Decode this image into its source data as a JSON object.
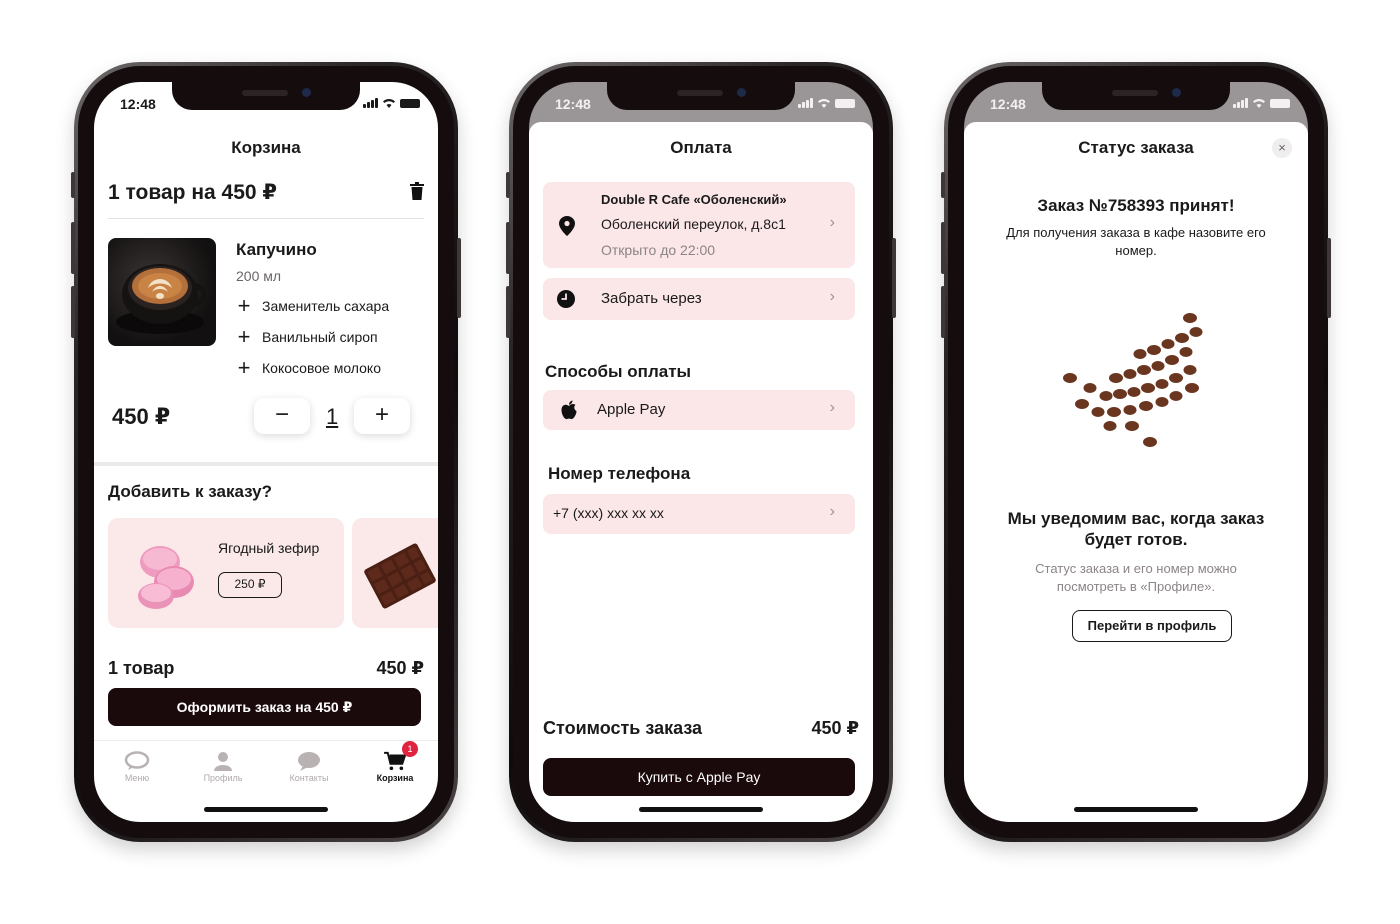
{
  "status_bar": {
    "time": "12:48"
  },
  "cart": {
    "title": "Корзина",
    "summary": "1 товар на 450 ₽",
    "item": {
      "name": "Капучино",
      "volume": "200 мл",
      "addons": [
        "Заменитель сахара",
        "Ванильный сироп",
        "Кокосовое молоко"
      ],
      "price": "450 ₽",
      "quantity": "1",
      "minus": "−",
      "plus": "+"
    },
    "upsell_title": "Добавить к заказу?",
    "upsell_items": [
      {
        "name": "Ягодный зефир",
        "price": "250 ₽"
      }
    ],
    "total_count": "1 товар",
    "total_price": "450 ₽",
    "checkout_button": "Оформить заказ на 450 ₽",
    "tabs": [
      {
        "label": "Меню",
        "icon": "chat-bubble-icon"
      },
      {
        "label": "Профиль",
        "icon": "user-icon"
      },
      {
        "label": "Контакты",
        "icon": "speech-icon"
      },
      {
        "label": "Корзина",
        "icon": "cart-icon",
        "badge": "1",
        "active": true
      }
    ]
  },
  "payment": {
    "title": "Оплата",
    "cafe_name": "Double R Cafe «Оболенский»",
    "cafe_address": "Оболенский переулок, д.8с1",
    "cafe_hours": "Открыто до 22:00",
    "pickup_label": "Забрать через",
    "methods_title": "Способы оплаты",
    "method": "Apple Pay",
    "phone_title": "Номер телефона",
    "phone_placeholder": "+7 (xxx) xxx xx xx",
    "cost_label": "Стоимость заказа",
    "cost_value": "450 ₽",
    "buy_button": "Купить с Apple Pay"
  },
  "order_status": {
    "title": "Статус заказа",
    "close": "×",
    "order_number": "Заказ №758393 принят!",
    "hint": "Для получения заказа в кафе назовите его номер.",
    "notify": "Мы уведомим вас, когда заказ будет готов.",
    "note": "Статус заказа и его номер можно посмотреть в «Профиле».",
    "profile_button": "Перейти в профиль"
  },
  "colors": {
    "accent_dark": "#1b0a0c",
    "pink_bg": "#fbe6e8",
    "badge_red": "#e0233f"
  }
}
